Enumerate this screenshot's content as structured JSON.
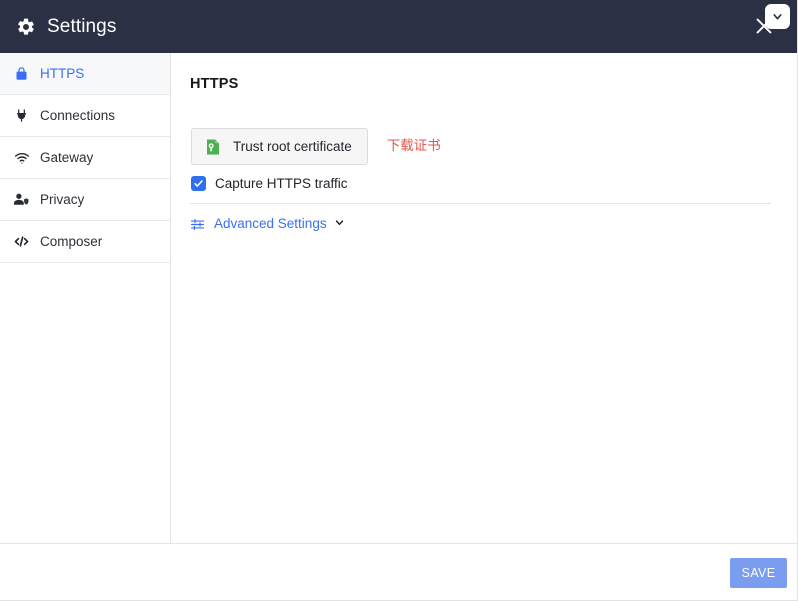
{
  "header": {
    "title": "Settings",
    "gear_icon": "gear-icon",
    "close_icon": "close-icon",
    "chevron_icon": "chevron-down-icon"
  },
  "sidebar": {
    "items": [
      {
        "label": "HTTPS",
        "icon": "lock-icon",
        "active": true
      },
      {
        "label": "Connections",
        "icon": "plug-icon",
        "active": false
      },
      {
        "label": "Gateway",
        "icon": "wifi-icon",
        "active": false
      },
      {
        "label": "Privacy",
        "icon": "user-shield-icon",
        "active": false
      },
      {
        "label": "Composer",
        "icon": "code-icon",
        "active": false
      }
    ]
  },
  "main": {
    "title": "HTTPS",
    "trust_button": {
      "label": "Trust root certificate",
      "icon": "certificate-icon"
    },
    "download_link": "下载证书",
    "capture_checkbox": {
      "label": "Capture HTTPS traffic",
      "checked": true,
      "icon": "check-icon"
    },
    "advanced": {
      "label": "Advanced Settings",
      "icon": "sliders-icon",
      "caret": "chevron-down-icon"
    }
  },
  "footer": {
    "save_label": "SAVE"
  },
  "colors": {
    "header_bg": "#2b3044",
    "accent_blue": "#3b6ef5",
    "checkbox_blue": "#2f6fed",
    "save_blue": "#7b9df0",
    "link_red": "#e8544a",
    "cert_green": "#4caf50"
  }
}
